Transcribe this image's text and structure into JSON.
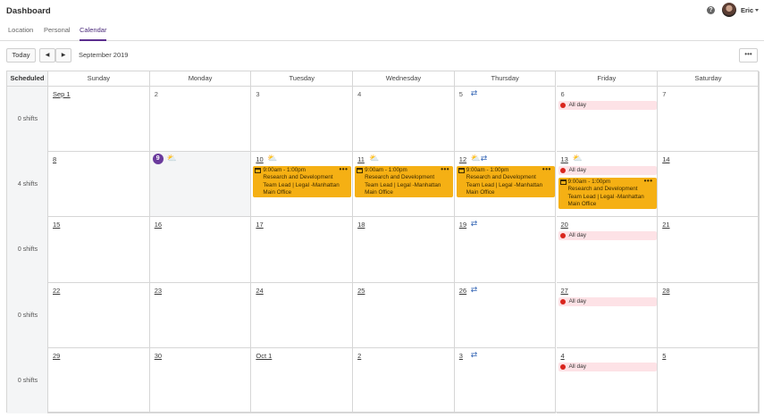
{
  "header": {
    "title": "Dashboard",
    "help_glyph": "?",
    "user_name": "Eric"
  },
  "tabs": [
    {
      "label": "Location"
    },
    {
      "label": "Personal"
    },
    {
      "label": "Calendar",
      "active": true
    }
  ],
  "toolbar": {
    "today_label": "Today",
    "prev_glyph": "◀",
    "next_glyph": "▶",
    "month_label": "September 2019",
    "more_glyph": "•••"
  },
  "calendar": {
    "scheduled_label": "Scheduled",
    "days": [
      "Sunday",
      "Monday",
      "Tuesday",
      "Wednesday",
      "Thursday",
      "Friday",
      "Saturday"
    ],
    "shift_counts": [
      "0 shifts",
      "4 shifts",
      "0 shifts",
      "0 shifts",
      "0 shifts"
    ],
    "weeks": [
      [
        {
          "label": "Sep 1"
        },
        {
          "label": "2"
        },
        {
          "label": "3"
        },
        {
          "label": "4"
        },
        {
          "label": "5",
          "icons": [
            "swap-icon"
          ]
        },
        {
          "label": "6",
          "allday": "All day"
        },
        {
          "label": "7"
        }
      ],
      [
        {
          "label": "8"
        },
        {
          "label": "9",
          "today": true,
          "icons": [
            "weather-icon"
          ]
        },
        {
          "label": "10",
          "icons": [
            "weather-icon"
          ],
          "shift": {
            "time": "9:00am - 1:00pm",
            "role": "Research and Development",
            "position": "Team Lead | Legal -Manhattan",
            "location": "Main Office"
          }
        },
        {
          "label": "11",
          "icons": [
            "weather-icon"
          ],
          "shift": {
            "time": "9:00am - 1:00pm",
            "role": "Research and Development",
            "position": "Team Lead | Legal -Manhattan",
            "location": "Main Office"
          }
        },
        {
          "label": "12",
          "icons": [
            "weather-icon",
            "swap-icon"
          ],
          "shift": {
            "time": "9:00am - 1:00pm",
            "role": "Research and Development",
            "position": "Team Lead | Legal -Manhattan",
            "location": "Main Office"
          }
        },
        {
          "label": "13",
          "icons": [
            "weather-icon"
          ],
          "allday": "All day",
          "shift": {
            "time": "9:00am - 1:00pm",
            "role": "Research and Development",
            "position": "Team Lead | Legal -Manhattan",
            "location": "Main Office"
          }
        },
        {
          "label": "14"
        }
      ],
      [
        {
          "label": "15"
        },
        {
          "label": "16"
        },
        {
          "label": "17"
        },
        {
          "label": "18"
        },
        {
          "label": "19",
          "icons": [
            "swap-icon"
          ]
        },
        {
          "label": "20",
          "allday": "All day"
        },
        {
          "label": "21"
        }
      ],
      [
        {
          "label": "22"
        },
        {
          "label": "23"
        },
        {
          "label": "24"
        },
        {
          "label": "25"
        },
        {
          "label": "26",
          "icons": [
            "swap-icon"
          ]
        },
        {
          "label": "27",
          "allday": "All day"
        },
        {
          "label": "28"
        }
      ],
      [
        {
          "label": "29"
        },
        {
          "label": "30"
        },
        {
          "label": "Oct 1"
        },
        {
          "label": "2"
        },
        {
          "label": "3",
          "icons": [
            "swap-icon"
          ]
        },
        {
          "label": "4",
          "allday": "All day"
        },
        {
          "label": "5"
        }
      ]
    ]
  },
  "colors": {
    "accent": "#5b2d8e",
    "shift": "#f5b014",
    "allday_bg": "#fde2e6",
    "allday_dot": "#d9251d"
  }
}
